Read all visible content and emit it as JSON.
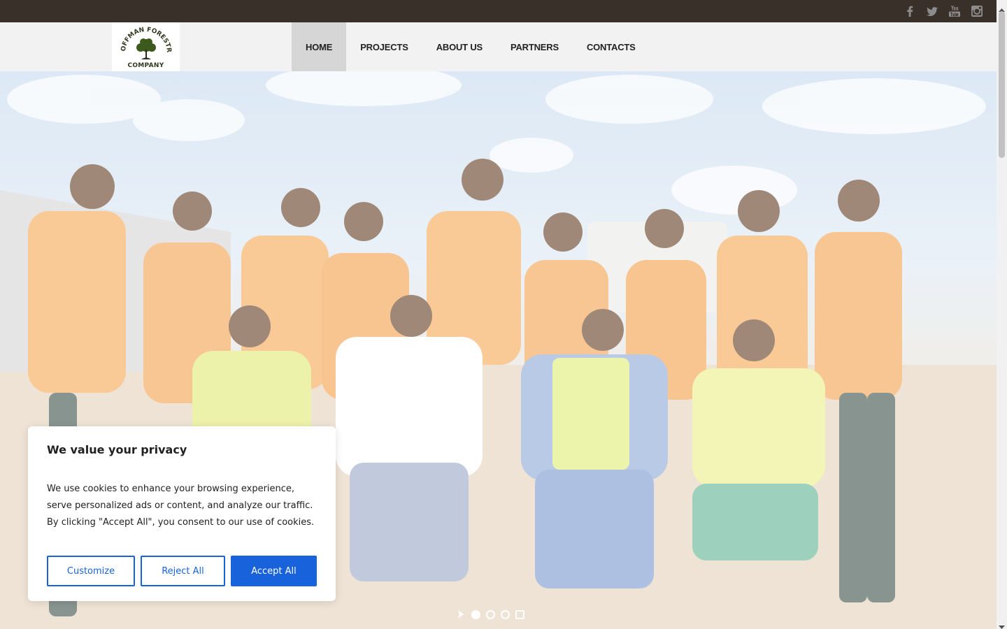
{
  "social": {
    "icons": [
      "facebook-icon",
      "twitter-icon",
      "youtube-icon",
      "instagram-icon"
    ],
    "icon_color": "#8c8c8c",
    "bar_color": "#3a302a"
  },
  "logo": {
    "arc_text": "HOFFMAN FORESTRY",
    "sub_text": "COMPANY"
  },
  "nav": {
    "items": [
      {
        "label": "HOME",
        "active": true
      },
      {
        "label": "PROJECTS"
      },
      {
        "label": "ABOUT US"
      },
      {
        "label": "PARTNERS"
      },
      {
        "label": "CONTACTS"
      }
    ]
  },
  "slider": {
    "dots": 4,
    "active_dot": 1
  },
  "cookie": {
    "title": "We value your privacy",
    "body": "We use cookies to enhance your browsing experience, serve personalized ads or content, and analyze our traffic. By clicking \"Accept All\", you consent to our use of cookies.",
    "customize_label": "Customize",
    "reject_label": "Reject All",
    "accept_label": "Accept All",
    "accent_color": "#1863dc"
  }
}
